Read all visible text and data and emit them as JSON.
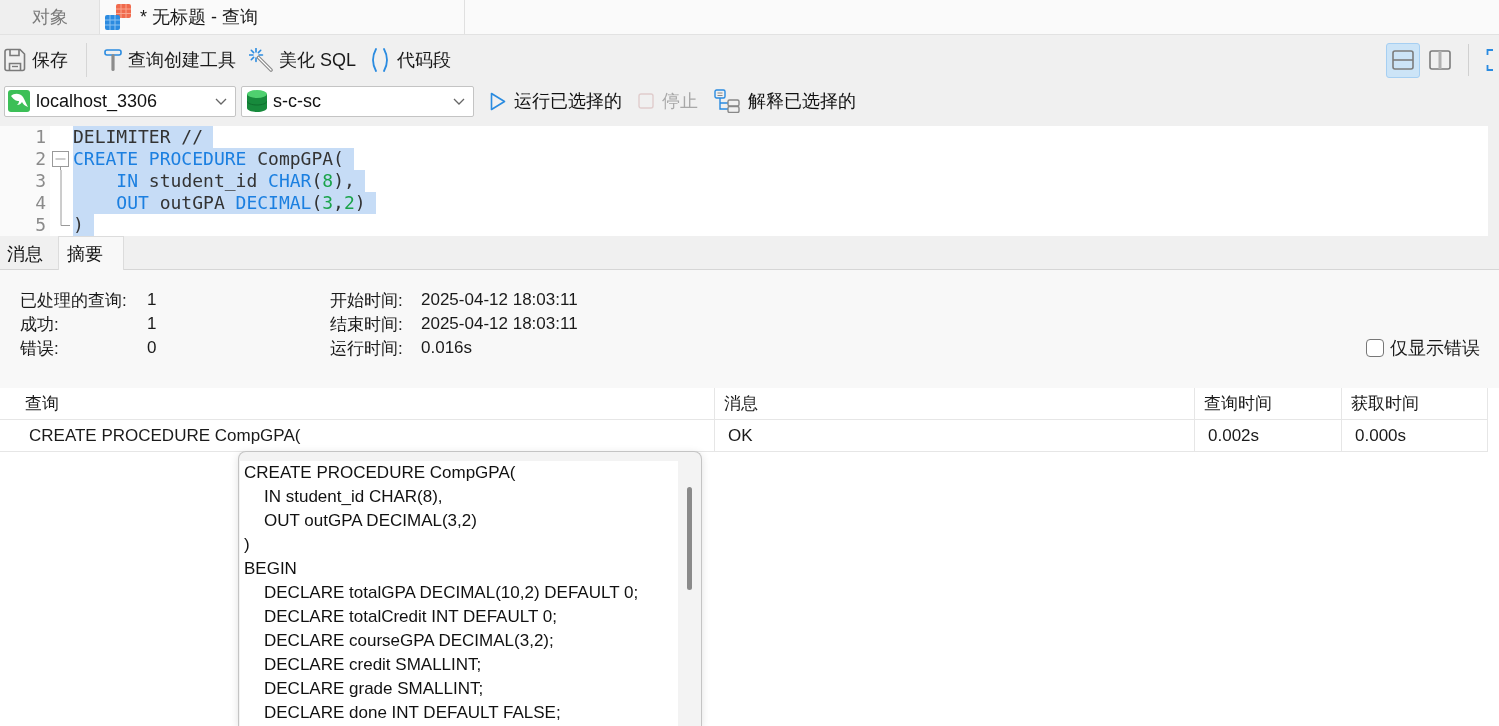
{
  "tabs": [
    {
      "label": "对象",
      "kind": "objects",
      "selected": false
    },
    {
      "label": "* 无标题 - 查询",
      "kind": "query",
      "selected": true
    }
  ],
  "toolbar": [
    {
      "kind": "save",
      "label": "保存"
    },
    {
      "kind": "separator"
    },
    {
      "kind": "query-builder",
      "label": "查询创建工具"
    },
    {
      "kind": "beautify",
      "label": "美化 SQL"
    },
    {
      "kind": "snippet",
      "label": "代码段"
    }
  ],
  "view_buttons": [
    {
      "kind": "split-horizontal",
      "selected": true
    },
    {
      "kind": "split-vertical",
      "selected": false
    }
  ],
  "connection": {
    "value": "localhost_3306"
  },
  "database": {
    "value": "s-c-sc"
  },
  "actions": [
    {
      "kind": "run",
      "label": "运行已选择的",
      "disabled": false
    },
    {
      "kind": "stop",
      "label": "停止",
      "disabled": true
    },
    {
      "kind": "explain",
      "label": "解释已选择的",
      "disabled": false
    }
  ],
  "editor": {
    "lines": [
      {
        "number": "1",
        "selected": true,
        "kind": "plain",
        "tokens": [
          {
            "kind": "plain",
            "text": "DELIMITER //"
          }
        ]
      },
      {
        "number": "2",
        "selected": true,
        "kind": "fold-start",
        "tokens": [
          {
            "kind": "keyword",
            "text": "CREATE PROCEDURE"
          },
          {
            "kind": "plain",
            "text": " CompGPA("
          }
        ]
      },
      {
        "number": "3",
        "selected": true,
        "kind": "fold-inside",
        "tokens": [
          {
            "kind": "keyword",
            "text": "    IN"
          },
          {
            "kind": "plain",
            "text": " student_id "
          },
          {
            "kind": "keyword",
            "text": "CHAR"
          },
          {
            "kind": "plain",
            "text": "("
          },
          {
            "kind": "number",
            "text": "8"
          },
          {
            "kind": "plain",
            "text": "),"
          }
        ]
      },
      {
        "number": "4",
        "selected": true,
        "kind": "fold-inside",
        "tokens": [
          {
            "kind": "keyword",
            "text": "    OUT"
          },
          {
            "kind": "plain",
            "text": " outGPA "
          },
          {
            "kind": "keyword",
            "text": "DECIMAL"
          },
          {
            "kind": "plain",
            "text": "("
          },
          {
            "kind": "number",
            "text": "3"
          },
          {
            "kind": "plain",
            "text": ","
          },
          {
            "kind": "number",
            "text": "2"
          },
          {
            "kind": "plain",
            "text": ")"
          }
        ]
      },
      {
        "number": "5",
        "selected": true,
        "kind": "fold-end",
        "tokens": [
          {
            "kind": "plain",
            "text": ")"
          }
        ]
      }
    ]
  },
  "result_tabs": [
    {
      "label": "消息",
      "selected": false
    },
    {
      "label": "摘要",
      "selected": true
    }
  ],
  "summary": {
    "stats": [
      {
        "label": "已处理的查询:",
        "value": "1"
      },
      {
        "label": "成功:",
        "value": "1"
      },
      {
        "label": "错误:",
        "value": "0"
      }
    ],
    "timing": [
      {
        "label": "开始时间:",
        "value": "2025-04-12 18:03:11"
      },
      {
        "label": "结束时间:",
        "value": "2025-04-12 18:03:11"
      },
      {
        "label": "运行时间:",
        "value": "0.016s"
      }
    ],
    "errors_only": {
      "label": "仅显示错误",
      "checked": false
    }
  },
  "results": {
    "columns": [
      "查询",
      "消息",
      "查询时间",
      "获取时间"
    ],
    "rows": [
      [
        "CREATE PROCEDURE CompGPA(",
        "OK",
        "0.002s",
        "0.000s"
      ]
    ]
  },
  "tooltip": {
    "lines": [
      {
        "text": "CREATE PROCEDURE CompGPA(",
        "children": [
          {
            "text": "IN student_id CHAR(8),"
          },
          {
            "text": "OUT outGPA DECIMAL(3,2)"
          }
        ]
      },
      {
        "text": ")"
      },
      {
        "text": "BEGIN",
        "children": [
          {
            "text": "DECLARE totalGPA DECIMAL(10,2) DEFAULT 0;"
          },
          {
            "text": "DECLARE totalCredit INT DEFAULT 0;"
          },
          {
            "text": "DECLARE courseGPA DECIMAL(3,2);"
          },
          {
            "text": "DECLARE credit SMALLINT;"
          },
          {
            "text": "DECLARE grade SMALLINT;"
          },
          {
            "text": "DECLARE done INT DEFAULT FALSE;"
          }
        ]
      }
    ]
  }
}
